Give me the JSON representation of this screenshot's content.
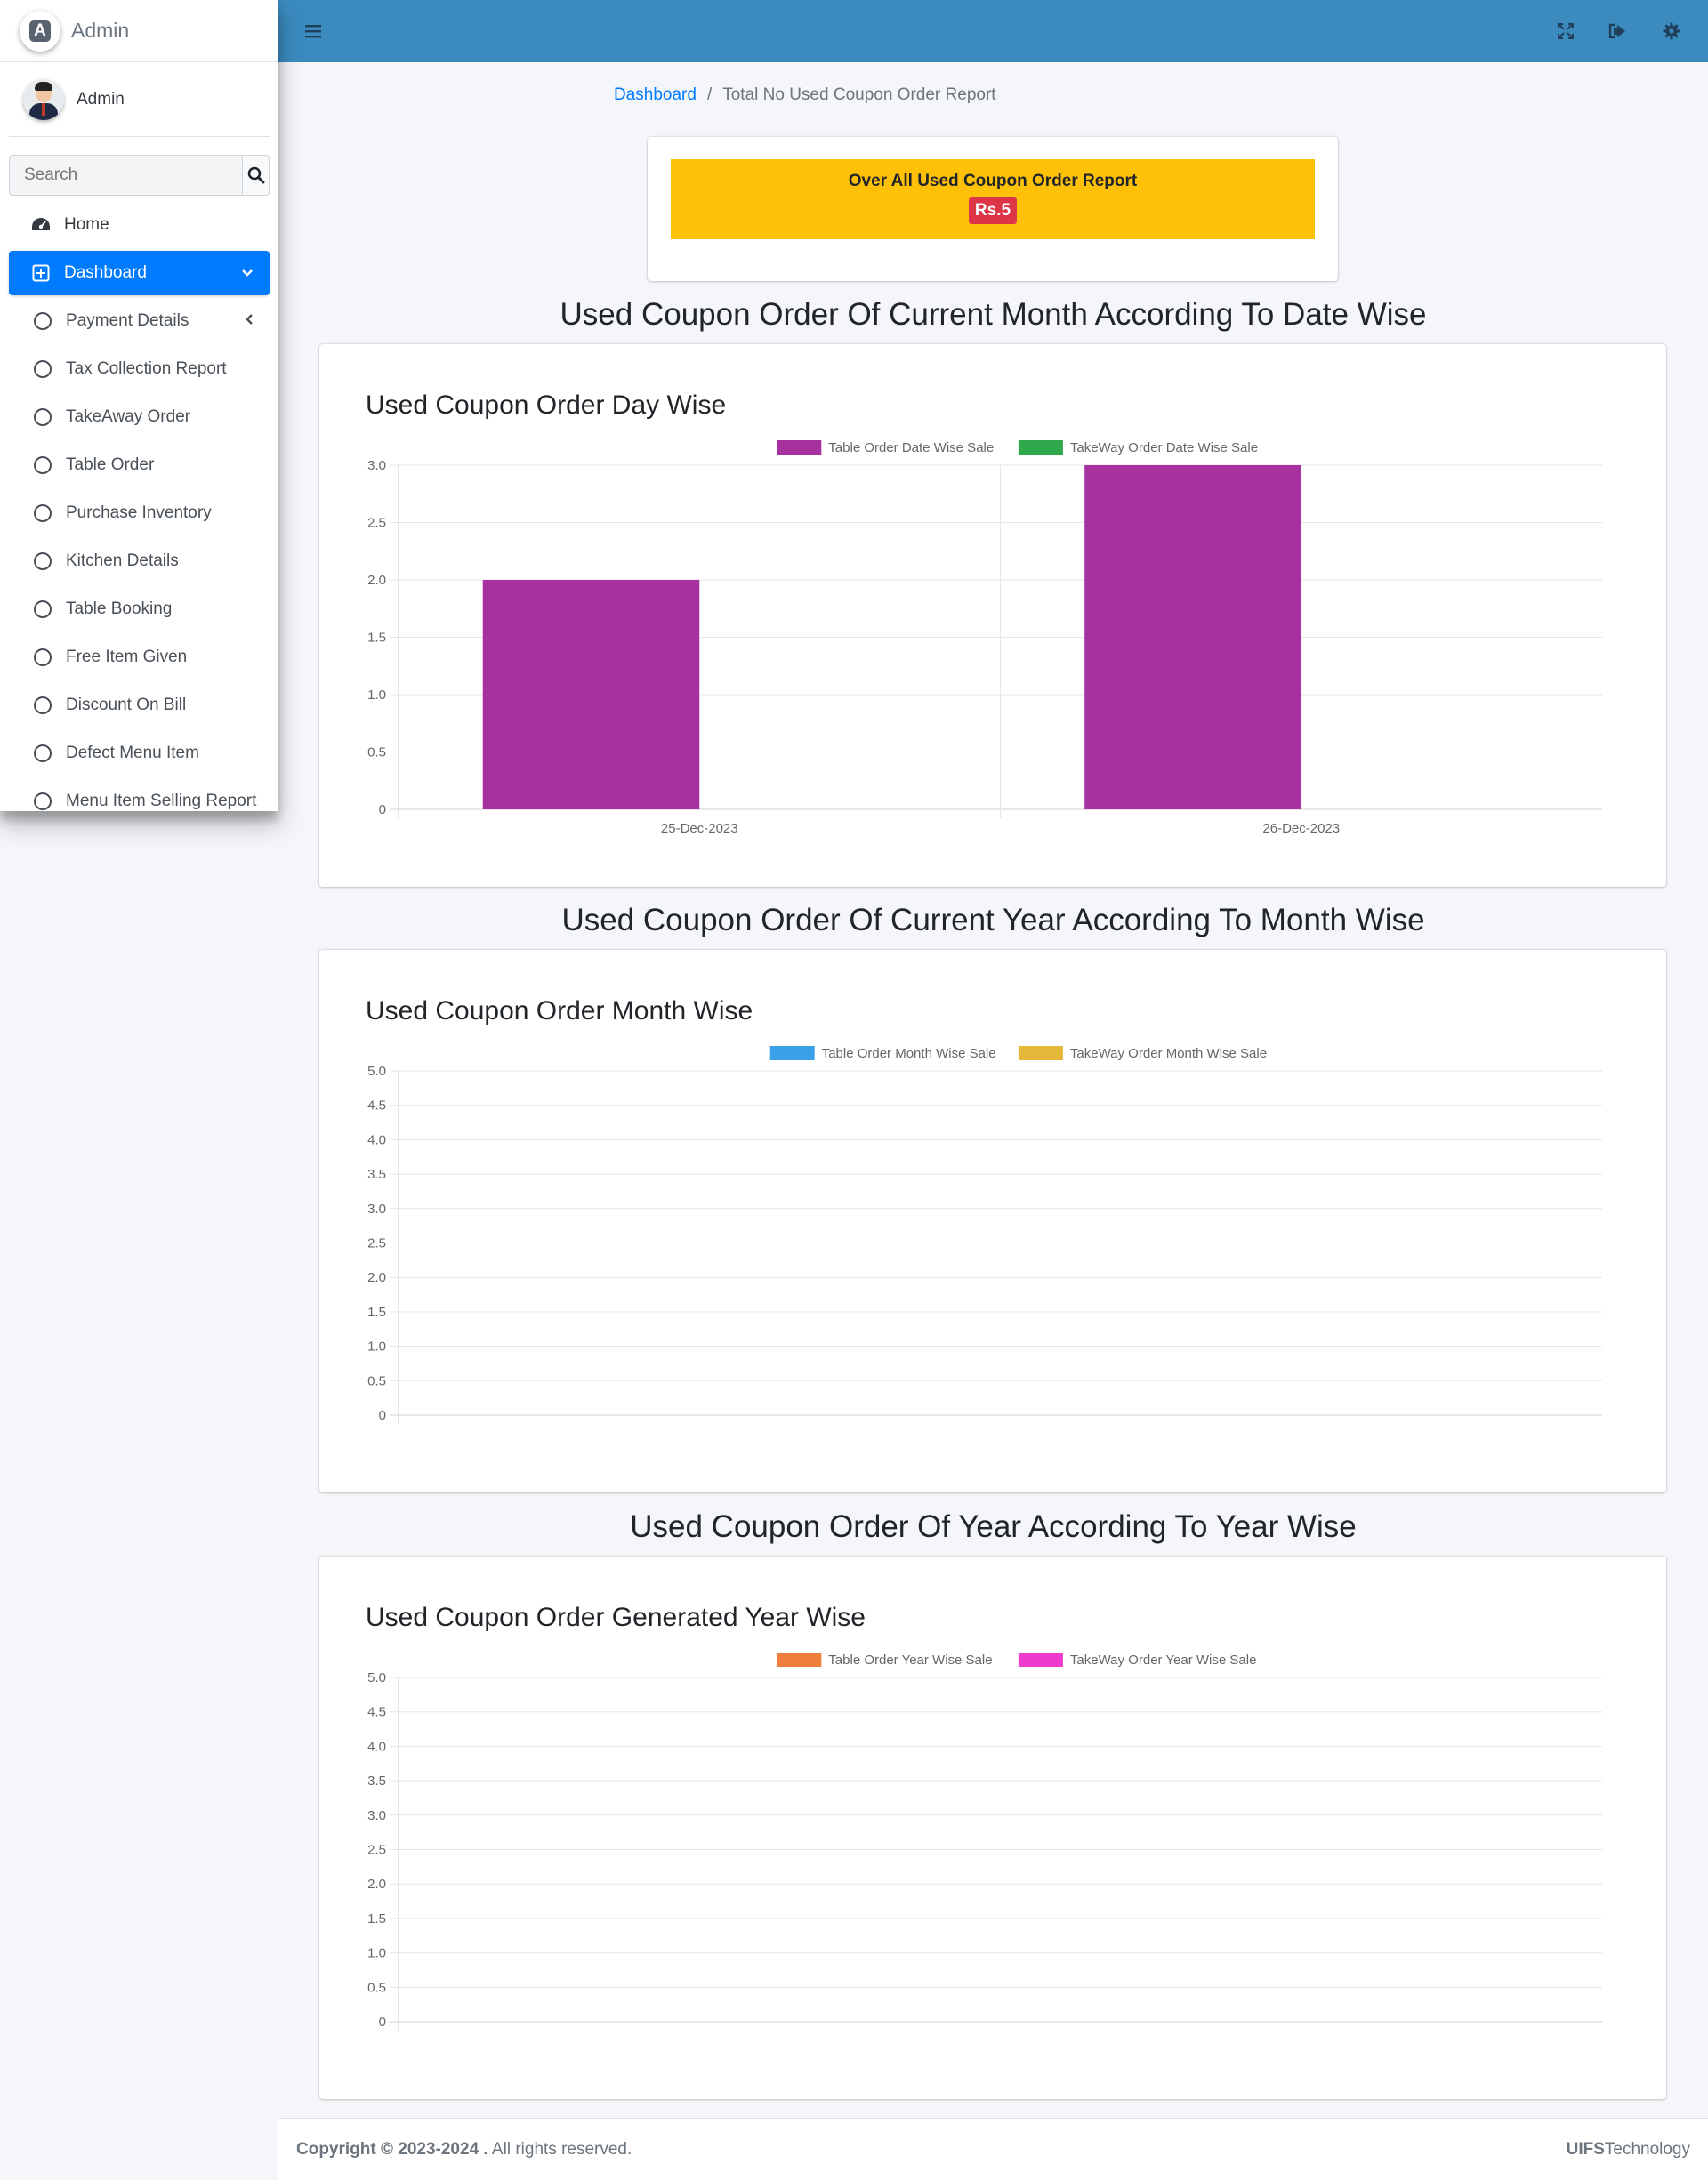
{
  "brand": {
    "text": "Admin",
    "logo_letter": "A"
  },
  "user": {
    "name": "Admin"
  },
  "search": {
    "placeholder": "Search"
  },
  "nav": {
    "home": "Home",
    "dashboard": "Dashboard",
    "items": [
      "Payment Details",
      "Tax Collection Report",
      "TakeAway Order",
      "Table Order",
      "Purchase Inventory",
      "Kitchen Details",
      "Table Booking",
      "Free Item Given",
      "Discount On Bill",
      "Defect Menu Item",
      "Menu Item Selling Report"
    ]
  },
  "breadcrumb": {
    "root": "Dashboard",
    "sep": "/",
    "current": "Total No Used Coupon Order Report"
  },
  "summary": {
    "title": "Over All Used Coupon Order Report",
    "value": "Rs.5"
  },
  "sections": {
    "day": "Used Coupon Order Of Current Month According To Date Wise",
    "month": "Used Coupon Order Of Current Year According To Month Wise",
    "year": "Used Coupon Order Of Year According To Year Wise"
  },
  "colors": {
    "topbar": "#3b8bbf",
    "active": "#007bff",
    "summary_bg": "#ffc107",
    "badge": "#dc3545"
  },
  "chart_data": [
    {
      "type": "bar",
      "title": "Used Coupon Order Day Wise",
      "categories": [
        "25-Dec-2023",
        "26-Dec-2023"
      ],
      "series": [
        {
          "name": "Table Order Date Wise Sale",
          "color": "#a6319f",
          "values": [
            2,
            3
          ]
        },
        {
          "name": "TakeWay Order Date Wise Sale",
          "color": "#2ea84a",
          "values": [
            0,
            0
          ]
        }
      ],
      "ylim": [
        0,
        3.0
      ],
      "yticks": [
        "0",
        "0.5",
        "1.0",
        "1.5",
        "2.0",
        "2.5",
        "3.0"
      ],
      "legend": "top-center",
      "grid": true
    },
    {
      "type": "bar",
      "title": "Used Coupon Order Month Wise",
      "categories": [],
      "series": [
        {
          "name": "Table Order Month Wise Sale",
          "color": "#3aa0e8",
          "values": []
        },
        {
          "name": "TakeWay Order Month Wise Sale",
          "color": "#e6b83a",
          "values": []
        }
      ],
      "ylim": [
        0,
        5.0
      ],
      "yticks": [
        "0",
        "0.5",
        "1.0",
        "1.5",
        "2.0",
        "2.5",
        "3.0",
        "3.5",
        "4.0",
        "4.5",
        "5.0"
      ],
      "legend": "top-center",
      "grid": true
    },
    {
      "type": "bar",
      "title": "Used Coupon Order Generated Year Wise",
      "categories": [],
      "series": [
        {
          "name": "Table Order Year Wise Sale",
          "color": "#ef7d3c",
          "values": []
        },
        {
          "name": "TakeWay Order Year Wise Sale",
          "color": "#ee3bcb",
          "values": []
        }
      ],
      "ylim": [
        0,
        5.0
      ],
      "yticks": [
        "0",
        "0.5",
        "1.0",
        "1.5",
        "2.0",
        "2.5",
        "3.0",
        "3.5",
        "4.0",
        "4.5",
        "5.0"
      ],
      "legend": "top-center",
      "grid": true
    }
  ],
  "footer": {
    "copyright": "Copyright © 2023-2024 .",
    "rights": " All rights reserved.",
    "company_bold": "UIFS",
    "company_rest": "Technology"
  }
}
